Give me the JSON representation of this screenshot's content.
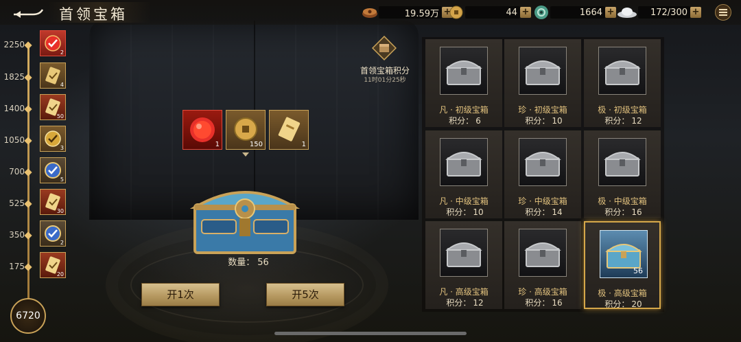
{
  "header": {
    "title": "首领宝箱",
    "resources": [
      {
        "icon": "coin-stack-icon",
        "value": "19.59万"
      },
      {
        "icon": "copper-coin-icon",
        "value": "44"
      },
      {
        "icon": "jade-disc-icon",
        "value": "1664"
      },
      {
        "icon": "silver-ingot-icon",
        "value": "172/300"
      }
    ],
    "plus_label": "+"
  },
  "progress": {
    "milestones": [
      {
        "score": "2250",
        "reward_icon": "red-orb-icon",
        "count": "2",
        "claimed": true
      },
      {
        "score": "1825",
        "reward_icon": "golden-scroll-icon",
        "count": "4",
        "claimed": false
      },
      {
        "score": "1400",
        "reward_icon": "golden-scroll-icon",
        "count": "50",
        "claimed": false
      },
      {
        "score": "1050",
        "reward_icon": "gold-medal-icon",
        "count": "3",
        "claimed": false
      },
      {
        "score": "700",
        "reward_icon": "blue-medal-icon",
        "count": "5",
        "claimed": false
      },
      {
        "score": "525",
        "reward_icon": "golden-scroll-icon",
        "count": "30",
        "claimed": false
      },
      {
        "score": "350",
        "reward_icon": "blue-medal-icon",
        "count": "2",
        "claimed": false
      },
      {
        "score": "175",
        "reward_icon": "golden-scroll-icon",
        "count": "20",
        "claimed": false
      }
    ],
    "current_score": "6720"
  },
  "score_box": {
    "label": "首领宝箱积分",
    "timer": "11时01分25秒"
  },
  "prizes": [
    {
      "icon": "red-orb-icon",
      "count": "1"
    },
    {
      "icon": "copper-coin-icon",
      "count": "150"
    },
    {
      "icon": "golden-scroll-icon",
      "count": "1"
    }
  ],
  "selected_chest": {
    "qty_label": "数量：",
    "qty_value": "56"
  },
  "buttons": {
    "open_once": "开1次",
    "open_five": "开5次"
  },
  "chests": [
    {
      "name": "凡 · 初级宝箱",
      "pts_label": "积分：",
      "pts": "6",
      "owned": "",
      "selected": false
    },
    {
      "name": "珍 · 初级宝箱",
      "pts_label": "积分：",
      "pts": "10",
      "owned": "",
      "selected": false
    },
    {
      "name": "极 · 初级宝箱",
      "pts_label": "积分：",
      "pts": "12",
      "owned": "",
      "selected": false
    },
    {
      "name": "凡 · 中级宝箱",
      "pts_label": "积分：",
      "pts": "10",
      "owned": "",
      "selected": false
    },
    {
      "name": "珍 · 中级宝箱",
      "pts_label": "积分：",
      "pts": "14",
      "owned": "",
      "selected": false
    },
    {
      "name": "极 · 中级宝箱",
      "pts_label": "积分：",
      "pts": "16",
      "owned": "",
      "selected": false
    },
    {
      "name": "凡 · 高级宝箱",
      "pts_label": "积分：",
      "pts": "12",
      "owned": "",
      "selected": false
    },
    {
      "name": "珍 · 高级宝箱",
      "pts_label": "积分：",
      "pts": "16",
      "owned": "",
      "selected": false
    },
    {
      "name": "极 · 高级宝箱",
      "pts_label": "积分：",
      "pts": "20",
      "owned": "56",
      "selected": true
    }
  ]
}
